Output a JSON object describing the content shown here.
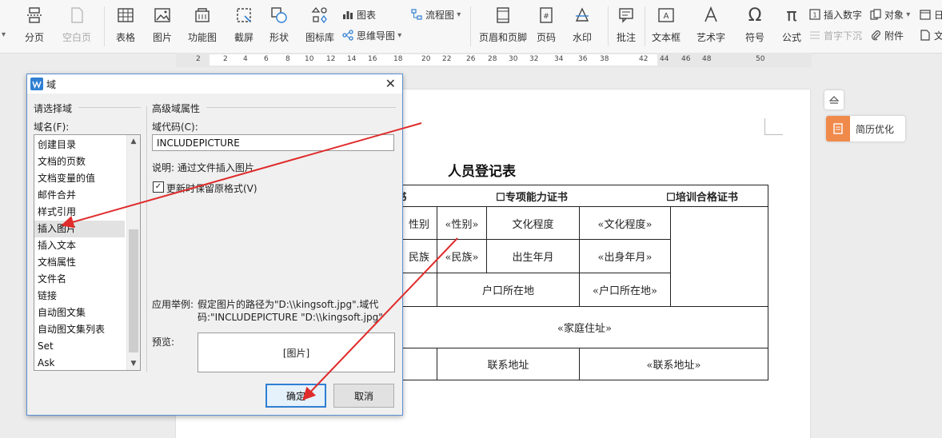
{
  "toolbar": {
    "items": [
      {
        "label": "分页",
        "icon": "page-break-icon",
        "has_dropdown": true,
        "disabled": false
      },
      {
        "label": "空白页",
        "icon": "blank-page-icon",
        "has_dropdown": true,
        "disabled": true
      },
      {
        "label": "表格",
        "icon": "table-icon",
        "has_dropdown": true,
        "disabled": false
      },
      {
        "label": "图片",
        "icon": "picture-icon",
        "has_dropdown": true,
        "disabled": false
      },
      {
        "label": "功能图",
        "icon": "function-chart-icon",
        "has_dropdown": true,
        "disabled": false
      },
      {
        "label": "截屏",
        "icon": "screenshot-icon",
        "has_dropdown": true,
        "disabled": false
      },
      {
        "label": "形状",
        "icon": "shape-icon",
        "has_dropdown": true,
        "disabled": false
      },
      {
        "label": "图标库",
        "icon": "icon-library-icon",
        "has_dropdown": false,
        "disabled": false
      },
      {
        "label": "页眉和页脚",
        "icon": "header-footer-icon",
        "has_dropdown": false,
        "disabled": false
      },
      {
        "label": "页码",
        "icon": "page-number-icon",
        "has_dropdown": true,
        "disabled": false
      },
      {
        "label": "水印",
        "icon": "watermark-icon",
        "has_dropdown": true,
        "disabled": false
      },
      {
        "label": "批注",
        "icon": "comment-icon",
        "has_dropdown": false,
        "disabled": false
      },
      {
        "label": "文本框",
        "icon": "textbox-icon",
        "has_dropdown": true,
        "disabled": false
      },
      {
        "label": "艺术字",
        "icon": "wordart-icon",
        "has_dropdown": true,
        "disabled": false
      },
      {
        "label": "符号",
        "icon": "symbol-icon",
        "has_dropdown": true,
        "disabled": false
      },
      {
        "label": "公式",
        "icon": "formula-icon",
        "has_dropdown": false,
        "disabled": false
      }
    ],
    "small_items": [
      {
        "label": "图表",
        "icon": "chart-icon",
        "has_dropdown": false,
        "disabled": false
      },
      {
        "label": "思维导图",
        "icon": "mindmap-icon",
        "has_dropdown": true,
        "disabled": false
      },
      {
        "label": "流程图",
        "icon": "flowchart-icon",
        "has_dropdown": true,
        "disabled": false
      },
      {
        "label": "插入数字",
        "icon": "insert-number-icon",
        "has_dropdown": false,
        "disabled": false
      },
      {
        "label": "首字下沉",
        "icon": "drop-cap-icon",
        "has_dropdown": false,
        "disabled": true
      },
      {
        "label": "对象",
        "icon": "object-icon",
        "has_dropdown": true,
        "disabled": false
      },
      {
        "label": "附件",
        "icon": "attachment-icon",
        "has_dropdown": false,
        "disabled": false
      },
      {
        "label": "日",
        "icon": "date-icon",
        "has_dropdown": false,
        "disabled": false
      },
      {
        "label": "文",
        "icon": "document-icon",
        "has_dropdown": false,
        "disabled": false
      }
    ]
  },
  "ruler": {
    "ticks": [
      "2",
      "2",
      "4",
      "6",
      "8",
      "10",
      "12",
      "14",
      "16",
      "18",
      "20",
      "22",
      "26",
      "28",
      "30",
      "32",
      "34",
      "36",
      "38",
      "42",
      "44",
      "46",
      "48",
      "50"
    ]
  },
  "document": {
    "title": "人员登记表",
    "header_row": [
      "书",
      "☐专项能力证书",
      "☐培训合格证书"
    ],
    "fields": {
      "gender_label": "性别",
      "gender_value": "«性别»",
      "edu_label": "文化程度",
      "edu_value": "«文化程度»",
      "ethnic_label": "民族",
      "ethnic_value": "«民族»",
      "birth_label": "出生年月",
      "birth_value": "«出身年月»",
      "hukou_label": "户口所在地",
      "hukou_value": "«户口所在地»",
      "address_value": "«家庭住址»",
      "contact_label": "联系地址",
      "contact_value": "«联系地址»"
    }
  },
  "side_panel": {
    "resume_label": "简历优化"
  },
  "dialog": {
    "title": "域",
    "select_field_header": "请选择域",
    "field_name_label": "域名(F):",
    "field_list": [
      "创建目录",
      "文档的页数",
      "文档变量的值",
      "邮件合并",
      "样式引用",
      "插入图片",
      "插入文本",
      "文档属性",
      "文件名",
      "链接",
      "自动图文集",
      "自动图文集列表",
      "Set",
      "Ask"
    ],
    "selected_index": 5,
    "advanced_header": "高级域属性",
    "code_label": "域代码(C):",
    "code_value": "INCLUDEPICTURE",
    "description": "说明: 通过文件插入图片",
    "preserve_format_label": "更新时保留原格式(V)",
    "preserve_format_checked": true,
    "example_label": "应用举例:",
    "example_line1": "假定图片的路径为\"D:\\\\kingsoft.jpg\".域代",
    "example_line2": "码:\"INCLUDEPICTURE \"D:\\\\kingsoft.jpg\"",
    "preview_label": "预览:",
    "preview_value": "[图片]",
    "ok_label": "确定",
    "cancel_label": "取消"
  },
  "colors": {
    "accent": "#2f7fd3",
    "annotation_arrow": "#e02b2b",
    "resume_orange": "#f08a4b"
  }
}
